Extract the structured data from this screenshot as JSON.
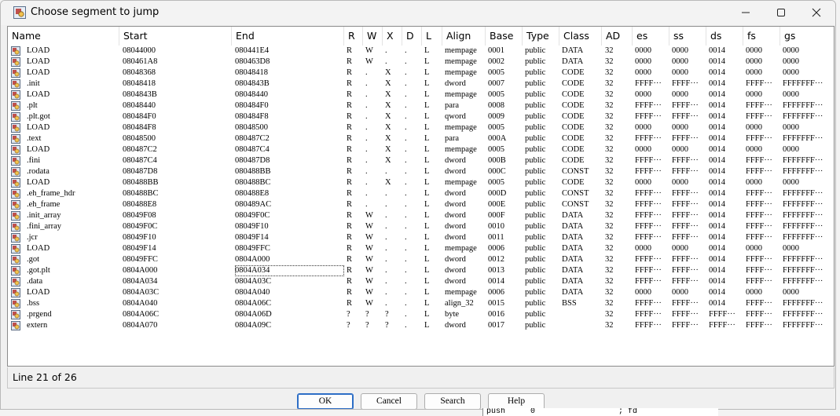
{
  "dialog": {
    "title": "Choose segment to jump"
  },
  "columns": [
    "Name",
    "Start",
    "End",
    "R",
    "W",
    "X",
    "D",
    "L",
    "Align",
    "Base",
    "Type",
    "Class",
    "AD",
    "es",
    "ss",
    "ds",
    "fs",
    "gs"
  ],
  "rows": [
    [
      "LOAD",
      "08044000",
      "080441E4",
      "R",
      "W",
      ".",
      ".",
      "L",
      "mempage",
      "0001",
      "public",
      "DATA",
      "32",
      "0000",
      "0000",
      "0014",
      "0000",
      "0000"
    ],
    [
      "LOAD",
      "080461A8",
      "080463D8",
      "R",
      "W",
      ".",
      ".",
      "L",
      "mempage",
      "0002",
      "public",
      "DATA",
      "32",
      "0000",
      "0000",
      "0014",
      "0000",
      "0000"
    ],
    [
      "LOAD",
      "08048368",
      "08048418",
      "R",
      ".",
      "X",
      ".",
      "L",
      "mempage",
      "0005",
      "public",
      "CODE",
      "32",
      "0000",
      "0000",
      "0014",
      "0000",
      "0000"
    ],
    [
      ".init",
      "08048418",
      "0804843B",
      "R",
      ".",
      "X",
      ".",
      "L",
      "dword",
      "0007",
      "public",
      "CODE",
      "32",
      "FFFF···",
      "FFFF···",
      "0014",
      "FFFF···",
      "FFFFFFF···"
    ],
    [
      "LOAD",
      "0804843B",
      "08048440",
      "R",
      ".",
      "X",
      ".",
      "L",
      "mempage",
      "0005",
      "public",
      "CODE",
      "32",
      "0000",
      "0000",
      "0014",
      "0000",
      "0000"
    ],
    [
      ".plt",
      "08048440",
      "080484F0",
      "R",
      ".",
      "X",
      ".",
      "L",
      "para",
      "0008",
      "public",
      "CODE",
      "32",
      "FFFF···",
      "FFFF···",
      "0014",
      "FFFF···",
      "FFFFFFF···"
    ],
    [
      ".plt.got",
      "080484F0",
      "080484F8",
      "R",
      ".",
      "X",
      ".",
      "L",
      "qword",
      "0009",
      "public",
      "CODE",
      "32",
      "FFFF···",
      "FFFF···",
      "0014",
      "FFFF···",
      "FFFFFFF···"
    ],
    [
      "LOAD",
      "080484F8",
      "08048500",
      "R",
      ".",
      "X",
      ".",
      "L",
      "mempage",
      "0005",
      "public",
      "CODE",
      "32",
      "0000",
      "0000",
      "0014",
      "0000",
      "0000"
    ],
    [
      ".text",
      "08048500",
      "080487C2",
      "R",
      ".",
      "X",
      ".",
      "L",
      "para",
      "000A",
      "public",
      "CODE",
      "32",
      "FFFF···",
      "FFFF···",
      "0014",
      "FFFF···",
      "FFFFFFF···"
    ],
    [
      "LOAD",
      "080487C2",
      "080487C4",
      "R",
      ".",
      "X",
      ".",
      "L",
      "mempage",
      "0005",
      "public",
      "CODE",
      "32",
      "0000",
      "0000",
      "0014",
      "0000",
      "0000"
    ],
    [
      ".fini",
      "080487C4",
      "080487D8",
      "R",
      ".",
      "X",
      ".",
      "L",
      "dword",
      "000B",
      "public",
      "CODE",
      "32",
      "FFFF···",
      "FFFF···",
      "0014",
      "FFFF···",
      "FFFFFFF···"
    ],
    [
      ".rodata",
      "080487D8",
      "080488BB",
      "R",
      ".",
      ".",
      ".",
      "L",
      "dword",
      "000C",
      "public",
      "CONST",
      "32",
      "FFFF···",
      "FFFF···",
      "0014",
      "FFFF···",
      "FFFFFFF···"
    ],
    [
      "LOAD",
      "080488BB",
      "080488BC",
      "R",
      ".",
      "X",
      ".",
      "L",
      "mempage",
      "0005",
      "public",
      "CODE",
      "32",
      "0000",
      "0000",
      "0014",
      "0000",
      "0000"
    ],
    [
      ".eh_frame_hdr",
      "080488BC",
      "080488E8",
      "R",
      ".",
      ".",
      ".",
      "L",
      "dword",
      "000D",
      "public",
      "CONST",
      "32",
      "FFFF···",
      "FFFF···",
      "0014",
      "FFFF···",
      "FFFFFFF···"
    ],
    [
      ".eh_frame",
      "080488E8",
      "080489AC",
      "R",
      ".",
      ".",
      ".",
      "L",
      "dword",
      "000E",
      "public",
      "CONST",
      "32",
      "FFFF···",
      "FFFF···",
      "0014",
      "FFFF···",
      "FFFFFFF···"
    ],
    [
      ".init_array",
      "08049F08",
      "08049F0C",
      "R",
      "W",
      ".",
      ".",
      "L",
      "dword",
      "000F",
      "public",
      "DATA",
      "32",
      "FFFF···",
      "FFFF···",
      "0014",
      "FFFF···",
      "FFFFFFF···"
    ],
    [
      ".fini_array",
      "08049F0C",
      "08049F10",
      "R",
      "W",
      ".",
      ".",
      "L",
      "dword",
      "0010",
      "public",
      "DATA",
      "32",
      "FFFF···",
      "FFFF···",
      "0014",
      "FFFF···",
      "FFFFFFF···"
    ],
    [
      ".jcr",
      "08049F10",
      "08049F14",
      "R",
      "W",
      ".",
      ".",
      "L",
      "dword",
      "0011",
      "public",
      "DATA",
      "32",
      "FFFF···",
      "FFFF···",
      "0014",
      "FFFF···",
      "FFFFFFF···"
    ],
    [
      "LOAD",
      "08049F14",
      "08049FFC",
      "R",
      "W",
      ".",
      ".",
      "L",
      "mempage",
      "0006",
      "public",
      "DATA",
      "32",
      "0000",
      "0000",
      "0014",
      "0000",
      "0000"
    ],
    [
      ".got",
      "08049FFC",
      "0804A000",
      "R",
      "W",
      ".",
      ".",
      "L",
      "dword",
      "0012",
      "public",
      "DATA",
      "32",
      "FFFF···",
      "FFFF···",
      "0014",
      "FFFF···",
      "FFFFFFF···"
    ],
    [
      ".got.plt",
      "0804A000",
      "0804A034",
      "R",
      "W",
      ".",
      ".",
      "L",
      "dword",
      "0013",
      "public",
      "DATA",
      "32",
      "FFFF···",
      "FFFF···",
      "0014",
      "FFFF···",
      "FFFFFFF···"
    ],
    [
      ".data",
      "0804A034",
      "0804A03C",
      "R",
      "W",
      ".",
      ".",
      "L",
      "dword",
      "0014",
      "public",
      "DATA",
      "32",
      "FFFF···",
      "FFFF···",
      "0014",
      "FFFF···",
      "FFFFFFF···"
    ],
    [
      "LOAD",
      "0804A03C",
      "0804A040",
      "R",
      "W",
      ".",
      ".",
      "L",
      "mempage",
      "0006",
      "public",
      "DATA",
      "32",
      "0000",
      "0000",
      "0014",
      "0000",
      "0000"
    ],
    [
      ".bss",
      "0804A040",
      "0804A06C",
      "R",
      "W",
      ".",
      ".",
      "L",
      "align_32",
      "0015",
      "public",
      "BSS",
      "32",
      "FFFF···",
      "FFFF···",
      "0014",
      "FFFF···",
      "FFFFFFF···"
    ],
    [
      ".prgend",
      "0804A06C",
      "0804A06D",
      "?",
      "?",
      "?",
      ".",
      "L",
      "byte",
      "0016",
      "public",
      "",
      "32",
      "FFFF···",
      "FFFF···",
      "FFFF···",
      "FFFF···",
      "FFFFFFF···"
    ],
    [
      "extern",
      "0804A070",
      "0804A09C",
      "?",
      "?",
      "?",
      ".",
      "L",
      "dword",
      "0017",
      "public",
      "",
      "32",
      "FFFF···",
      "FFFF···",
      "FFFF···",
      "FFFF···",
      "FFFFFFF···"
    ]
  ],
  "status": {
    "line_text": "Line 21 of 26"
  },
  "buttons": {
    "ok": "OK",
    "cancel": "Cancel",
    "search": "Search",
    "help": "Help"
  },
  "background_window": {
    "mnemonic": "push",
    "operand": "0",
    "comment": "; fd"
  }
}
